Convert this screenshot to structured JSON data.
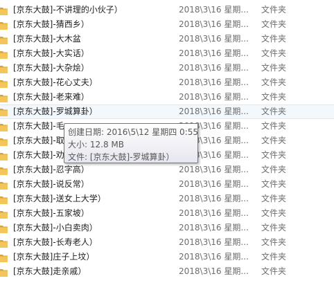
{
  "colors": {
    "folder": "#f2c65b",
    "folder_dark": "#d9a43a",
    "hover_background": "#f3f8fd"
  },
  "files": [
    {
      "name": "[京东大鼓]-不讲理的小伙子）",
      "date": "2018\\3\\16 星期...",
      "type": "文件夹",
      "icon": "folder-icon"
    },
    {
      "name": "[京东大鼓]-猜西乡）",
      "date": "2018\\3\\16 星期...",
      "type": "文件夹",
      "icon": "folder-icon"
    },
    {
      "name": "[京东大鼓]-大木盆",
      "date": "2018\\3\\16 星期...",
      "type": "文件夹",
      "icon": "folder-icon"
    },
    {
      "name": "[京东大鼓]-大实话）",
      "date": "2018\\3\\16 星期...",
      "type": "文件夹",
      "icon": "folder-icon"
    },
    {
      "name": "[京东大鼓]-大杂烩）",
      "date": "2018\\3\\16 星期...",
      "type": "文件夹",
      "icon": "folder-icon"
    },
    {
      "name": "[京东大鼓]-花心丈夫）",
      "date": "2018\\3\\16 星期...",
      "type": "文件夹",
      "icon": "folder-icon"
    },
    {
      "name": "[京东大鼓]-老来难）",
      "date": "2018\\3\\16 星期...",
      "type": "文件夹",
      "icon": "folder-icon"
    },
    {
      "name": "[京东大鼓]-罗城算卦）",
      "date": "2018\\3\\16 星期...",
      "type": "文件夹",
      "icon": "folder-icon",
      "hover": true
    },
    {
      "name": "[京东大鼓]-毛",
      "date": "2018\\3\\16 星期...",
      "type": "文件夹",
      "icon": "folder-icon"
    },
    {
      "name": "[京东大鼓]-取",
      "date": "2018\\3\\16 星期...",
      "type": "文件夹",
      "icon": "folder-icon"
    },
    {
      "name": "[京东大鼓]-劝人）",
      "date": "2018\\3\\16 星期...",
      "type": "文件夹",
      "icon": "folder-icon"
    },
    {
      "name": "[京东大鼓]-忍字高）",
      "date": "2018\\3\\16 星期...",
      "type": "文件夹",
      "icon": "folder-icon"
    },
    {
      "name": "[京东大鼓]-说反常）",
      "date": "2018\\3\\16 星期...",
      "type": "文件夹",
      "icon": "folder-icon"
    },
    {
      "name": "[京东大鼓]-送女上大学）",
      "date": "2018\\3\\16 星期...",
      "type": "文件夹",
      "icon": "folder-icon"
    },
    {
      "name": "[京东大鼓]-五家坡）",
      "date": "2018\\3\\16 星期...",
      "type": "文件夹",
      "icon": "folder-icon"
    },
    {
      "name": "[京东大鼓]-小白卖肉）",
      "date": "2018\\3\\16 星期...",
      "type": "文件夹",
      "icon": "folder-icon"
    },
    {
      "name": "[京东大鼓]-长寿老人）",
      "date": "2018\\3\\16 星期...",
      "type": "文件夹",
      "icon": "folder-icon"
    },
    {
      "name": "[京东大鼓]庄子上坟）",
      "date": "2018\\3\\16 星期...",
      "type": "文件夹",
      "icon": "folder-icon"
    },
    {
      "name": "[京东大鼓]走亲戚）",
      "date": "2018\\3\\16 星期...",
      "type": "文件夹",
      "icon": "folder-icon"
    }
  ],
  "tooltip": {
    "created": "创建日期: 2016\\5\\12 星期四 0:55",
    "size": "大小: 12.8 MB",
    "files": "文件: [京东大鼓]-罗城算卦）"
  }
}
